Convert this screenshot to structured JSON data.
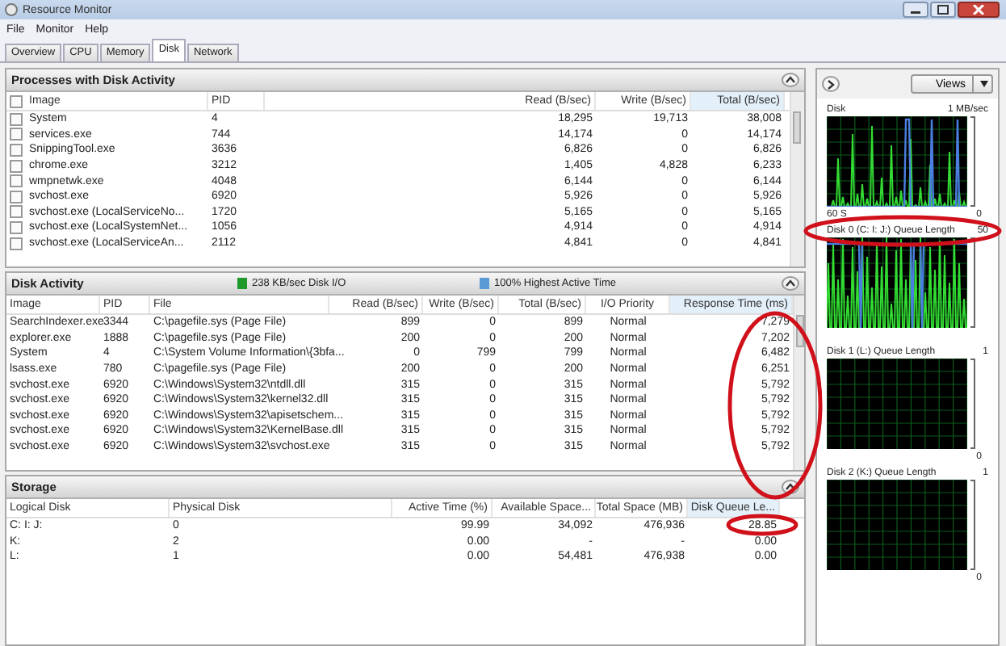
{
  "window": {
    "title": "Resource Monitor"
  },
  "menu": [
    "File",
    "Monitor",
    "Help"
  ],
  "tabs": [
    {
      "label": "Overview",
      "selected": false
    },
    {
      "label": "CPU",
      "selected": false
    },
    {
      "label": "Memory",
      "selected": false
    },
    {
      "label": "Disk",
      "selected": true
    },
    {
      "label": "Network",
      "selected": false
    }
  ],
  "processes": {
    "title": "Processes with Disk Activity",
    "columns": [
      {
        "label": "Image",
        "sorted": false
      },
      {
        "label": "PID",
        "sorted": false
      },
      {
        "label": "Read (B/sec)",
        "sorted": false
      },
      {
        "label": "Write (B/sec)",
        "sorted": false
      },
      {
        "label": "Total (B/sec)",
        "sorted": true
      }
    ],
    "rows": [
      {
        "checked": false,
        "cells": [
          "System",
          "4",
          "18,295",
          "19,713",
          "38,008"
        ]
      },
      {
        "checked": false,
        "cells": [
          "services.exe",
          "744",
          "14,174",
          "0",
          "14,174"
        ]
      },
      {
        "checked": false,
        "cells": [
          "SnippingTool.exe",
          "3636",
          "6,826",
          "0",
          "6,826"
        ]
      },
      {
        "checked": false,
        "cells": [
          "chrome.exe",
          "3212",
          "1,405",
          "4,828",
          "6,233"
        ]
      },
      {
        "checked": false,
        "cells": [
          "wmpnetwk.exe",
          "4048",
          "6,144",
          "0",
          "6,144"
        ]
      },
      {
        "checked": false,
        "cells": [
          "svchost.exe",
          "6920",
          "5,926",
          "0",
          "5,926"
        ]
      },
      {
        "checked": false,
        "cells": [
          "svchost.exe (LocalServiceNo...",
          "1720",
          "5,165",
          "0",
          "5,165"
        ]
      },
      {
        "checked": false,
        "cells": [
          "svchost.exe (LocalSystemNet...",
          "1056",
          "4,914",
          "0",
          "4,914"
        ]
      },
      {
        "checked": false,
        "cells": [
          "svchost.exe (LocalServiceAn...",
          "2112",
          "4,841",
          "0",
          "4,841"
        ]
      }
    ]
  },
  "disk_activity": {
    "title": "Disk Activity",
    "legend": [
      {
        "text": "238 KB/sec Disk I/O",
        "color": "#1f9a2a"
      },
      {
        "text": "100% Highest Active Time",
        "color": "#5b9bd5"
      }
    ],
    "columns": [
      {
        "label": "Image",
        "sorted": false
      },
      {
        "label": "PID",
        "sorted": false
      },
      {
        "label": "File",
        "sorted": false
      },
      {
        "label": "Read (B/sec)",
        "sorted": false
      },
      {
        "label": "Write (B/sec)",
        "sorted": false
      },
      {
        "label": "Total (B/sec)",
        "sorted": false
      },
      {
        "label": "I/O Priority",
        "sorted": false
      },
      {
        "label": "Response Time (ms)",
        "sorted": true
      }
    ],
    "rows": [
      [
        "SearchIndexer.exe",
        "3344",
        "C:\\pagefile.sys (Page File)",
        "899",
        "0",
        "899",
        "Normal",
        "7,279"
      ],
      [
        "explorer.exe",
        "1888",
        "C:\\pagefile.sys (Page File)",
        "200",
        "0",
        "200",
        "Normal",
        "7,202"
      ],
      [
        "System",
        "4",
        "C:\\System Volume Information\\{3bfa...",
        "0",
        "799",
        "799",
        "Normal",
        "6,482"
      ],
      [
        "lsass.exe",
        "780",
        "C:\\pagefile.sys (Page File)",
        "200",
        "0",
        "200",
        "Normal",
        "6,251"
      ],
      [
        "svchost.exe",
        "6920",
        "C:\\Windows\\System32\\ntdll.dll",
        "315",
        "0",
        "315",
        "Normal",
        "5,792"
      ],
      [
        "svchost.exe",
        "6920",
        "C:\\Windows\\System32\\kernel32.dll",
        "315",
        "0",
        "315",
        "Normal",
        "5,792"
      ],
      [
        "svchost.exe",
        "6920",
        "C:\\Windows\\System32\\apisetschem...",
        "315",
        "0",
        "315",
        "Normal",
        "5,792"
      ],
      [
        "svchost.exe",
        "6920",
        "C:\\Windows\\System32\\KernelBase.dll",
        "315",
        "0",
        "315",
        "Normal",
        "5,792"
      ],
      [
        "svchost.exe",
        "6920",
        "C:\\Windows\\System32\\svchost.exe",
        "315",
        "0",
        "315",
        "Normal",
        "5,792"
      ]
    ]
  },
  "storage": {
    "title": "Storage",
    "columns": [
      {
        "label": "Logical Disk",
        "sorted": false
      },
      {
        "label": "Physical Disk",
        "sorted": false
      },
      {
        "label": "Active Time (%)",
        "sorted": false
      },
      {
        "label": "Available Space...",
        "sorted": false
      },
      {
        "label": "Total Space (MB)",
        "sorted": false
      },
      {
        "label": "Disk Queue Le...",
        "sorted": true
      }
    ],
    "rows": [
      [
        "C: I: J:",
        "0",
        "99.99",
        "34,092",
        "476,936",
        "28.85"
      ],
      [
        "K:",
        "2",
        "0.00",
        "-",
        "-",
        "0.00"
      ],
      [
        "L:",
        "1",
        "0.00",
        "54,481",
        "476,938",
        "0.00"
      ]
    ]
  },
  "graph_panel": {
    "views_button": "Views",
    "graphs": [
      {
        "kind": "activity",
        "title": "Disk",
        "max": "1 MB/sec",
        "min": "0",
        "time_label": "60 S"
      },
      {
        "kind": "busy",
        "title": "Disk 0 (C: I: J:) Queue Length",
        "max": "50"
      },
      {
        "kind": "idle",
        "title": "Disk 1 (L:) Queue Length",
        "max": "1",
        "min": "0"
      },
      {
        "kind": "idle",
        "title": "Disk 2 (K:) Queue Length",
        "max": "1",
        "min": "0"
      }
    ]
  }
}
